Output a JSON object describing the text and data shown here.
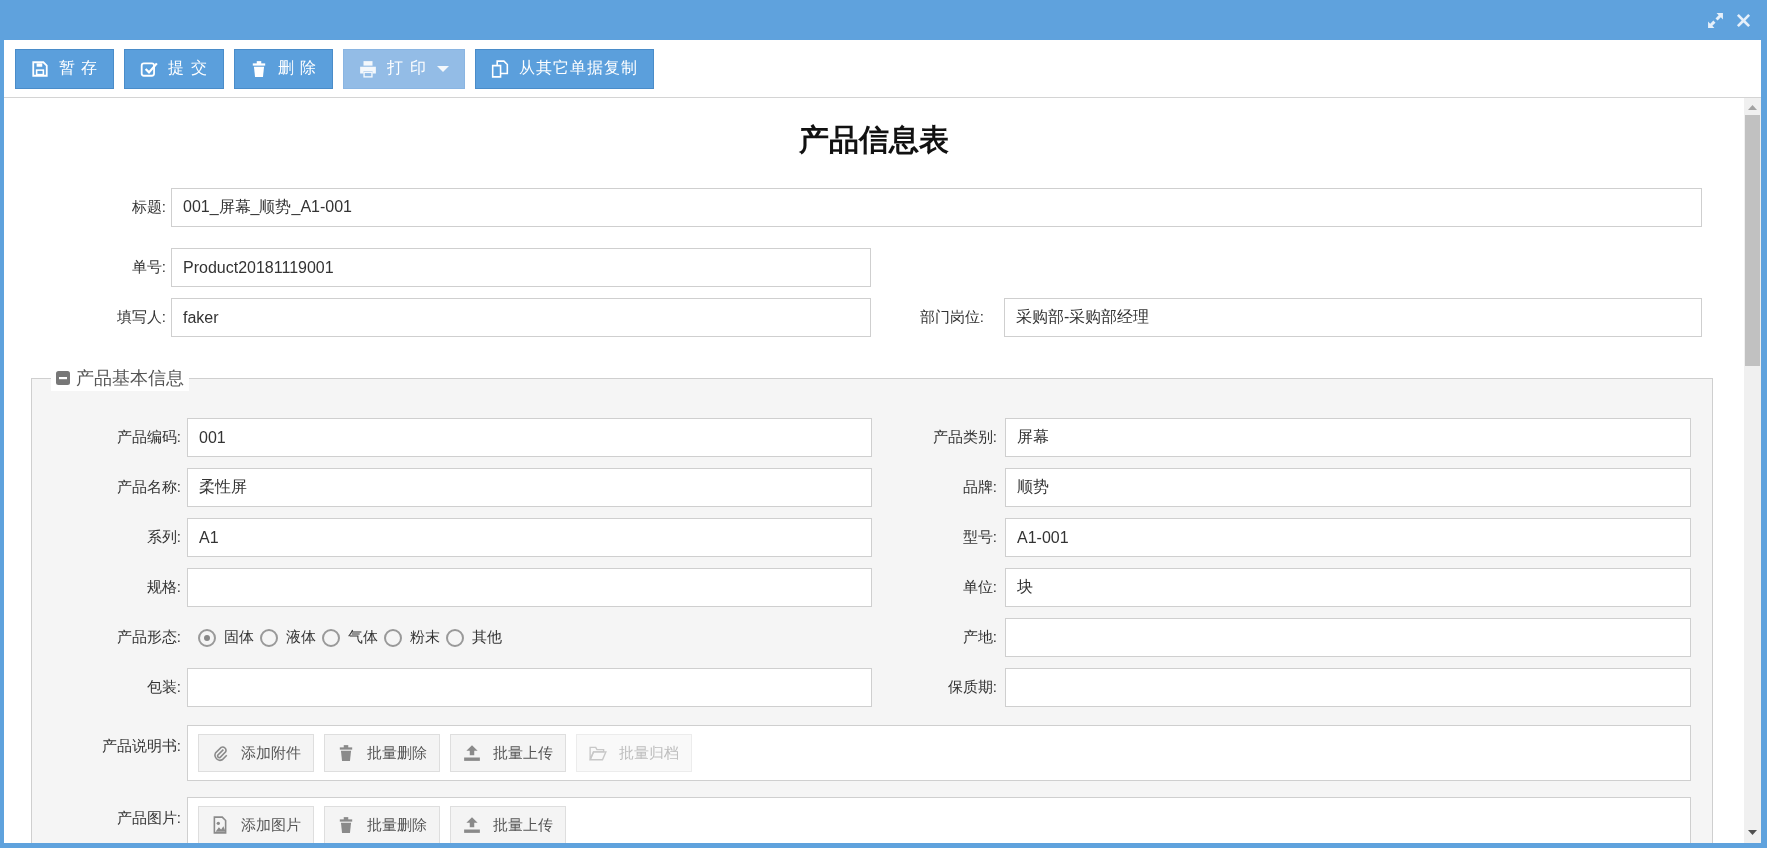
{
  "toolbar": [
    {
      "kind": "save",
      "label": "暂 存",
      "disabled": false,
      "dropdown": false
    },
    {
      "kind": "check",
      "label": "提 交",
      "disabled": false,
      "dropdown": false
    },
    {
      "kind": "trash",
      "label": "删 除",
      "disabled": false,
      "dropdown": false
    },
    {
      "kind": "print",
      "label": "打 印",
      "disabled": true,
      "dropdown": true
    },
    {
      "kind": "copy",
      "label": "从其它单据复制",
      "disabled": false,
      "dropdown": false
    }
  ],
  "form": {
    "title": "产品信息表",
    "title_field": {
      "label": "标题:",
      "value": "001_屏幕_顺势_A1-001"
    },
    "number_field": {
      "label": "单号:",
      "value": "Product20181119001"
    },
    "author_row": [
      {
        "label": "填写人:",
        "value": "faker"
      },
      {
        "label": "部门岗位:",
        "value": "采购部-采购部经理"
      }
    ]
  },
  "section": {
    "title": "产品基本信息",
    "expanded": true,
    "rows": [
      [
        {
          "kind": "text",
          "label": "产品编码:",
          "value": "001"
        },
        {
          "kind": "text",
          "label": "产品类别:",
          "value": "屏幕"
        }
      ],
      [
        {
          "kind": "text",
          "label": "产品名称:",
          "value": "柔性屏"
        },
        {
          "kind": "text",
          "label": "品牌:",
          "value": "顺势"
        }
      ],
      [
        {
          "kind": "text",
          "label": "系列:",
          "value": "A1"
        },
        {
          "kind": "text",
          "label": "型号:",
          "value": "A1-001"
        }
      ],
      [
        {
          "kind": "text",
          "label": "规格:"
        },
        {
          "kind": "text",
          "label": "单位:",
          "value": "块"
        }
      ],
      [
        {
          "kind": "radio",
          "label": "产品形态:",
          "options": [
            {
              "label": "固体",
              "selected": true
            },
            {
              "label": "液体",
              "selected": false
            },
            {
              "label": "气体",
              "selected": false
            },
            {
              "label": "粉末",
              "selected": false
            },
            {
              "label": "其他",
              "selected": false
            }
          ]
        },
        {
          "kind": "text",
          "label": "产地:"
        }
      ],
      [
        {
          "kind": "text",
          "label": "包装:"
        },
        {
          "kind": "text",
          "label": "保质期:"
        }
      ]
    ],
    "attachments": [
      {
        "label": "产品说明书:",
        "buttons": [
          {
            "kind": "paperclip",
            "label": "添加附件",
            "disabled": false
          },
          {
            "kind": "trash",
            "label": "批量删除",
            "disabled": false
          },
          {
            "kind": "upload",
            "label": "批量上传",
            "disabled": false
          },
          {
            "kind": "folder",
            "label": "批量归档",
            "disabled": true
          }
        ]
      },
      {
        "label": "产品图片:",
        "buttons": [
          {
            "kind": "image",
            "label": "添加图片",
            "disabled": false
          },
          {
            "kind": "trash",
            "label": "批量删除",
            "disabled": false
          },
          {
            "kind": "upload",
            "label": "批量上传",
            "disabled": false
          }
        ]
      }
    ]
  }
}
